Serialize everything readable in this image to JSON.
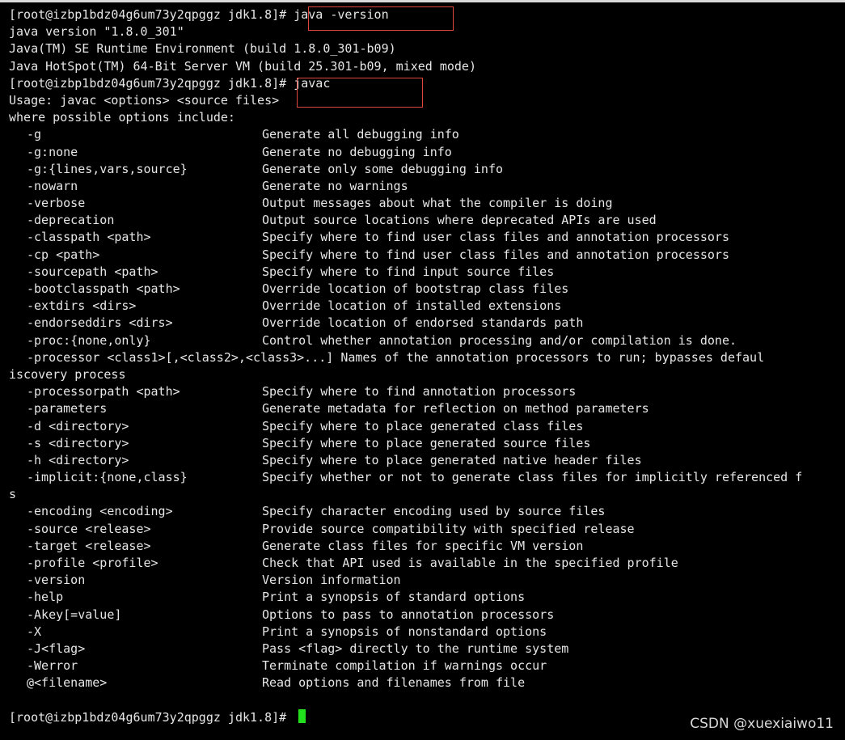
{
  "terminal": {
    "lines_top": [
      {
        "kind": "prompt",
        "prompt": "[root@izbp1bdz04g6um73y2qpggz jdk1.8]# ",
        "command": "java -version"
      },
      {
        "kind": "text",
        "text": "java version \"1.8.0_301\""
      },
      {
        "kind": "text",
        "text": "Java(TM) SE Runtime Environment (build 1.8.0_301-b09)"
      },
      {
        "kind": "text",
        "text": "Java HotSpot(TM) 64-Bit Server VM (build 25.301-b09, mixed mode)"
      },
      {
        "kind": "prompt",
        "prompt": "[root@izbp1bdz04g6um73y2qpggz jdk1.8]# ",
        "command": "javac"
      },
      {
        "kind": "text",
        "text": "Usage: javac <options> <source files>"
      },
      {
        "kind": "text",
        "text": "where possible options include:"
      }
    ],
    "options": [
      {
        "opt": "-g",
        "desc": "Generate all debugging info"
      },
      {
        "opt": "-g:none",
        "desc": "Generate no debugging info"
      },
      {
        "opt": "-g:{lines,vars,source}",
        "desc": "Generate only some debugging info"
      },
      {
        "opt": "-nowarn",
        "desc": "Generate no warnings"
      },
      {
        "opt": "-verbose",
        "desc": "Output messages about what the compiler is doing"
      },
      {
        "opt": "-deprecation",
        "desc": "Output source locations where deprecated APIs are used"
      },
      {
        "opt": "-classpath <path>",
        "desc": "Specify where to find user class files and annotation processors"
      },
      {
        "opt": "-cp <path>",
        "desc": "Specify where to find user class files and annotation processors"
      },
      {
        "opt": "-sourcepath <path>",
        "desc": "Specify where to find input source files"
      },
      {
        "opt": "-bootclasspath <path>",
        "desc": "Override location of bootstrap class files"
      },
      {
        "opt": "-extdirs <dirs>",
        "desc": "Override location of installed extensions"
      },
      {
        "opt": "-endorseddirs <dirs>",
        "desc": "Override location of endorsed standards path"
      },
      {
        "opt": "-proc:{none,only}",
        "desc": "Control whether annotation processing and/or compilation is done."
      },
      {
        "opt": "__processor_line__",
        "desc": ""
      },
      {
        "opt": "-processorpath <path>",
        "desc": "Specify where to find annotation processors"
      },
      {
        "opt": "-parameters",
        "desc": "Generate metadata for reflection on method parameters"
      },
      {
        "opt": "-d <directory>",
        "desc": "Specify where to place generated class files"
      },
      {
        "opt": "-s <directory>",
        "desc": "Specify where to place generated source files"
      },
      {
        "opt": "-h <directory>",
        "desc": "Specify where to place generated native header files"
      },
      {
        "opt": "-implicit:{none,class}",
        "desc": "Specify whether or not to generate class files for implicitly referenced f"
      },
      {
        "opt": "__wrap_s__",
        "desc": ""
      },
      {
        "opt": "-encoding <encoding>",
        "desc": "Specify character encoding used by source files"
      },
      {
        "opt": "-source <release>",
        "desc": "Provide source compatibility with specified release"
      },
      {
        "opt": "-target <release>",
        "desc": "Generate class files for specific VM version"
      },
      {
        "opt": "-profile <profile>",
        "desc": "Check that API used is available in the specified profile"
      },
      {
        "opt": "-version",
        "desc": "Version information"
      },
      {
        "opt": "-help",
        "desc": "Print a synopsis of standard options"
      },
      {
        "opt": "-Akey[=value]",
        "desc": "Options to pass to annotation processors"
      },
      {
        "opt": "-X",
        "desc": "Print a synopsis of nonstandard options"
      },
      {
        "opt": "-J<flag>",
        "desc": "Pass <flag> directly to the runtime system"
      },
      {
        "opt": "-Werror",
        "desc": "Terminate compilation if warnings occur"
      },
      {
        "opt": "@<filename>",
        "desc": "Read options and filenames from file"
      }
    ],
    "processor_line": "-processor <class1>[,<class2>,<class3>...] Names of the annotation processors to run; bypasses defaul",
    "processor_wrap": "iscovery process",
    "implicit_wrap": "s",
    "final_prompt": "[root@izbp1bdz04g6um73y2qpggz jdk1.8]# ",
    "cursor_color": "#22e01b",
    "text_color": "#e6e6e6",
    "background": "#000000"
  },
  "highlight_color": "#e0473f",
  "watermark": "CSDN @xuexiaiwo11"
}
